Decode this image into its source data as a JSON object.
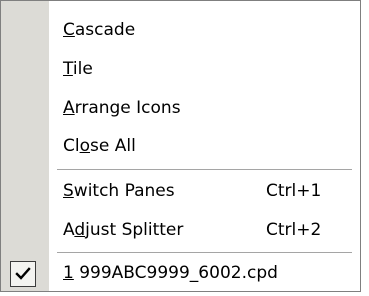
{
  "menu": {
    "items": [
      {
        "pre": "",
        "acc": "C",
        "post": "ascade",
        "shortcut": ""
      },
      {
        "pre": "",
        "acc": "T",
        "post": "ile",
        "shortcut": ""
      },
      {
        "pre": "",
        "acc": "A",
        "post": "rrange Icons",
        "shortcut": ""
      },
      {
        "pre": "Cl",
        "acc": "o",
        "post": "se All",
        "shortcut": ""
      },
      {
        "pre": "",
        "acc": "S",
        "post": "witch Panes",
        "shortcut": "Ctrl+1"
      },
      {
        "pre": "A",
        "acc": "d",
        "post": "just Splitter",
        "shortcut": "Ctrl+2"
      },
      {
        "pre": "",
        "acc": "1",
        "post": " 999ABC9999_6002.cpd",
        "shortcut": "",
        "checked": true
      }
    ]
  },
  "icons": {
    "check": "checkmark-icon"
  }
}
